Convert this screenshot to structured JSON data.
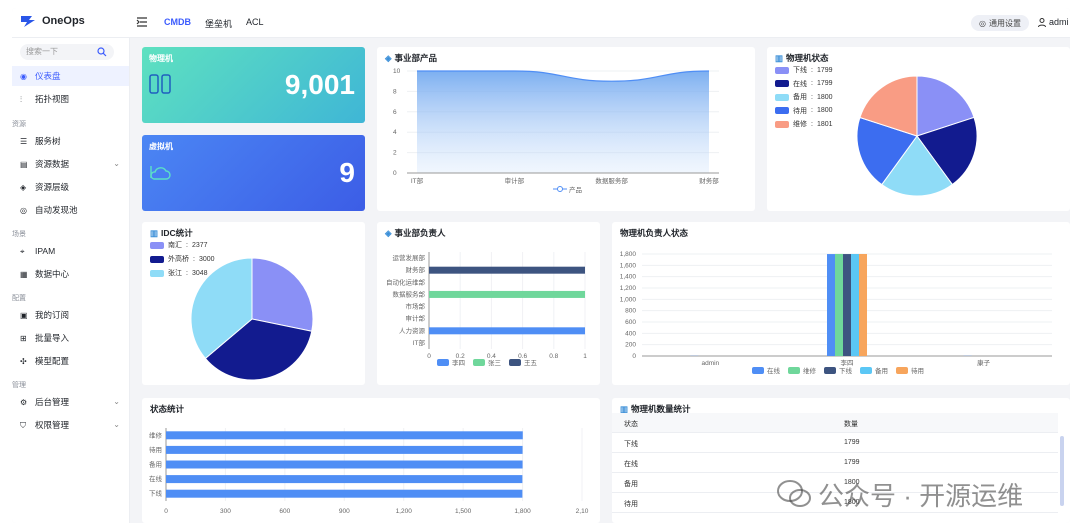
{
  "app": {
    "name": "OneOps"
  },
  "topnav": {
    "items": [
      "CMDB",
      "堡垒机",
      "ACL"
    ],
    "settings": "通用设置",
    "user": "admi"
  },
  "sidebar": {
    "search_placeholder": "搜索一下",
    "items": [
      {
        "label": "仪表盘",
        "icon": "dashboard-icon",
        "active": true
      },
      {
        "label": "拓扑视图",
        "icon": "topology-icon"
      },
      {
        "section": "资源"
      },
      {
        "label": "服务树",
        "icon": "tree-icon"
      },
      {
        "label": "资源数据",
        "icon": "data-icon",
        "chevron": true
      },
      {
        "label": "资源层级",
        "icon": "layers-icon"
      },
      {
        "label": "自动发现池",
        "icon": "discover-icon"
      },
      {
        "section": "场景"
      },
      {
        "label": "IPAM",
        "icon": "ipam-icon"
      },
      {
        "label": "数据中心",
        "icon": "datacenter-icon"
      },
      {
        "section": "配置"
      },
      {
        "label": "我的订阅",
        "icon": "subscribe-icon"
      },
      {
        "label": "批量导入",
        "icon": "import-icon"
      },
      {
        "label": "模型配置",
        "icon": "model-icon"
      },
      {
        "section": "管理"
      },
      {
        "label": "后台管理",
        "icon": "admin-icon",
        "chevron": true
      },
      {
        "label": "权限管理",
        "icon": "permission-icon",
        "chevron": true
      }
    ]
  },
  "stats": {
    "physical": {
      "title": "物理机",
      "value": "9,001"
    },
    "virtual": {
      "title": "虚拟机",
      "value": "9"
    }
  },
  "colors": {
    "accent": "#3b5bfd",
    "blue": "#4f8ef5",
    "green": "#6fd79b",
    "navy": "#3d5480",
    "sky": "#5bc7f5",
    "orange": "#f7a55c"
  },
  "chart_data": [
    {
      "id": "dept_products",
      "title": "事业部产品",
      "type": "area",
      "categories": [
        "IT部",
        "审计部",
        "数据服务部",
        "财务部"
      ],
      "series": [
        {
          "name": "产品",
          "values": [
            10,
            10,
            9,
            10
          ]
        }
      ],
      "ylim": [
        0,
        10
      ],
      "yticks": [
        0,
        2,
        4,
        6,
        8,
        10
      ]
    },
    {
      "id": "pm_status",
      "title": "物理机状态",
      "type": "pie",
      "slices": [
        {
          "label": "下线",
          "value": 1799,
          "color": "#8a90f6"
        },
        {
          "label": "在线",
          "value": 1799,
          "color": "#121b8f"
        },
        {
          "label": "备用",
          "value": 1800,
          "color": "#8fdcf7"
        },
        {
          "label": "待用",
          "value": 1800,
          "color": "#3c6df0"
        },
        {
          "label": "维修",
          "value": 1801,
          "color": "#f99c84"
        }
      ]
    },
    {
      "id": "idc",
      "title": "IDC统计",
      "type": "pie",
      "slices": [
        {
          "label": "南汇",
          "value": 2377,
          "color": "#8a90f6"
        },
        {
          "label": "外高桥",
          "value": 3000,
          "color": "#121b8f"
        },
        {
          "label": "张江",
          "value": 3048,
          "color": "#8fdcf7"
        }
      ]
    },
    {
      "id": "dept_owner",
      "title": "事业部负责人",
      "type": "bar",
      "categories": [
        "运营发展部",
        "财务部",
        "自动化运维部",
        "数据服务部",
        "市场部",
        "审计部",
        "人力资源",
        "IT部"
      ],
      "series": [
        {
          "name": "李四",
          "values": [
            0,
            0,
            0,
            0,
            0,
            0,
            1,
            0
          ],
          "color": "#4f8ef5"
        },
        {
          "name": "张三",
          "values": [
            0,
            0,
            0,
            1,
            0,
            0,
            0,
            0
          ],
          "color": "#6fd79b"
        },
        {
          "name": "王五",
          "values": [
            0,
            1,
            0,
            0,
            0,
            0,
            0,
            0
          ],
          "color": "#3d5480"
        }
      ],
      "xlim": [
        0,
        1
      ],
      "xticks": [
        "0",
        "0.2",
        "0.4",
        "0.6",
        "0.8",
        "1"
      ]
    },
    {
      "id": "pm_owner_status",
      "title": "物理机负责人状态",
      "type": "bar",
      "categories": [
        "admin",
        "李四",
        "康子"
      ],
      "series": [
        {
          "name": "在线",
          "values": [
            3,
            1799,
            3
          ],
          "color": "#4f8ef5"
        },
        {
          "name": "维修",
          "values": [
            0,
            1801,
            0
          ],
          "color": "#6fd79b"
        },
        {
          "name": "下线",
          "values": [
            0,
            1799,
            0
          ],
          "color": "#3d5480"
        },
        {
          "name": "备用",
          "values": [
            0,
            1800,
            0
          ],
          "color": "#5bc7f5"
        },
        {
          "name": "待用",
          "values": [
            0,
            1800,
            0
          ],
          "color": "#f7a55c"
        }
      ],
      "ylim": [
        0,
        1800
      ],
      "yticks": [
        "0",
        "200",
        "400",
        "600",
        "800",
        "1,000",
        "1,200",
        "1,400",
        "1,600",
        "1,800"
      ]
    },
    {
      "id": "status_stats",
      "title": "状态统计",
      "type": "bar",
      "categories": [
        "维修",
        "待用",
        "备用",
        "在线",
        "下线"
      ],
      "values": [
        1801,
        1800,
        1800,
        1799,
        1799
      ],
      "xlim": [
        0,
        2100
      ],
      "xticks": [
        "0",
        "300",
        "600",
        "900",
        "1,200",
        "1,500",
        "1,800",
        "2,10"
      ]
    }
  ],
  "pm_count_table": {
    "title": "物理机数量统计",
    "headers": [
      "状态",
      "数量"
    ],
    "rows": [
      [
        "下线",
        "1799"
      ],
      [
        "在线",
        "1799"
      ],
      [
        "备用",
        "1800"
      ],
      [
        "待用",
        "1800"
      ]
    ]
  },
  "watermark": "公众号 · 开源运维"
}
